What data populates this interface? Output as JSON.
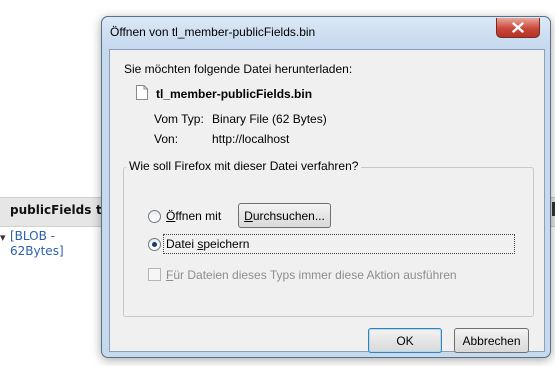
{
  "background_page": {
    "column_header": "publicFields",
    "column_header_next": "tl",
    "cell_value": "[BLOB - 62Bytes]"
  },
  "dialog": {
    "title": "Öffnen von tl_member-publicFields.bin",
    "lead_text": "Sie möchten folgende Datei herunterladen:",
    "file": {
      "name": "tl_member-publicFields.bin",
      "type_label": "Vom Typ:",
      "type_value": "Binary File (62 Bytes)",
      "from_label": "Von:",
      "from_value": "http://localhost"
    },
    "action_group": {
      "legend": "Wie soll Firefox mit dieser Datei verfahren?",
      "open_with_label": "Öffnen mit",
      "browse_button": "Durchsuchen...",
      "save_label": "Datei speichern",
      "always_label": "Für Dateien dieses Typs immer diese Aktion ausführen",
      "selected": "save"
    },
    "ok_button": "OK",
    "cancel_button": "Abbrechen"
  },
  "icons": {
    "close": "close-icon",
    "file": "file-icon"
  },
  "colors": {
    "frame": "#c7d9ec",
    "close_button": "#c9473a",
    "link_blue": "#2b5fb0"
  }
}
